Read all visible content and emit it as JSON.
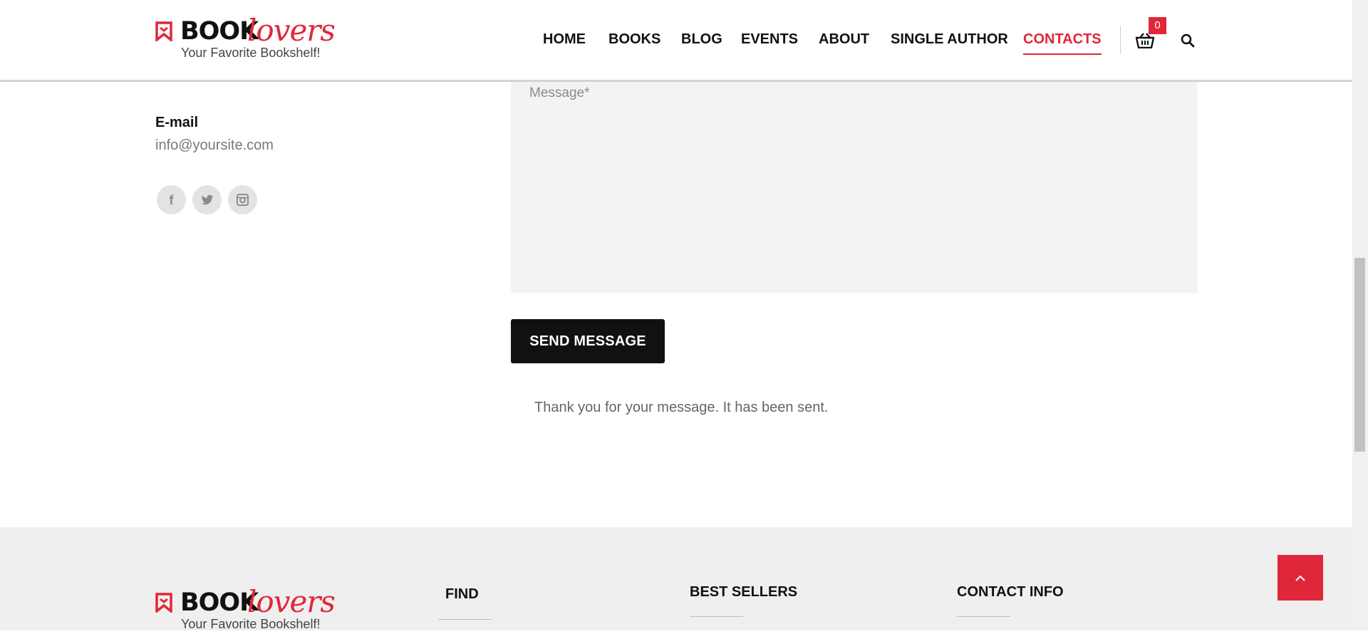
{
  "brand": {
    "book": "BOOK",
    "lovers": "lovers",
    "tagline": "Your Favorite Bookshelf!",
    "accent_color": "#e0273a"
  },
  "nav": {
    "items": [
      {
        "label": "HOME",
        "active": false
      },
      {
        "label": "BOOKS",
        "active": false
      },
      {
        "label": "BLOG",
        "active": false
      },
      {
        "label": "EVENTS",
        "active": false
      },
      {
        "label": "ABOUT",
        "active": false
      },
      {
        "label": "SINGLE AUTHOR",
        "active": false
      },
      {
        "label": "CONTACTS",
        "active": true
      }
    ],
    "cart_count": "0",
    "cart_icon": "basket-icon",
    "search_icon": "search-icon"
  },
  "contact": {
    "email_label": "E-mail",
    "email_value": "info@yoursite.com",
    "social": [
      "facebook-icon",
      "twitter-icon",
      "instagram-icon"
    ]
  },
  "form": {
    "message_placeholder": "Message*",
    "send_label": "SEND MESSAGE",
    "status_text": "Thank you for your message. It has been sent."
  },
  "footer": {
    "headings": [
      "FIND",
      "BEST SELLERS",
      "CONTACT INFO"
    ],
    "to_top_icon": "chevron-up-icon"
  }
}
